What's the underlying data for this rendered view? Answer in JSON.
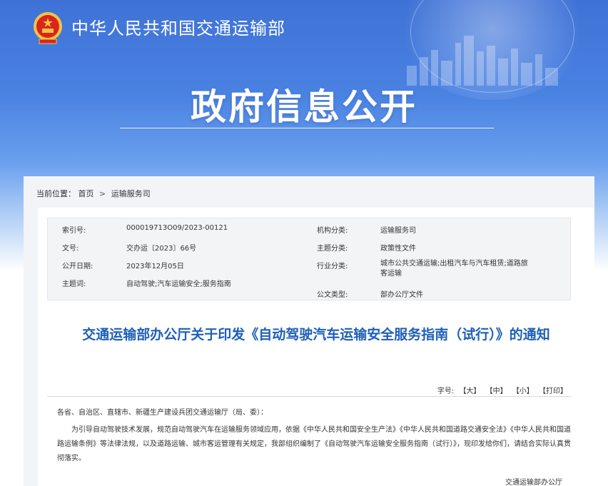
{
  "header": {
    "site_title": "中华人民共和国交通运输部",
    "hero_title": "政府信息公开"
  },
  "breadcrumb": {
    "label": "当前位置：",
    "items": [
      "首页",
      "运输服务司"
    ],
    "separator": ">"
  },
  "meta": {
    "rows": [
      {
        "label1": "索引号:",
        "value1": "000019713O09/2023-00121",
        "label2": "机构分类:",
        "value2": "运输服务司"
      },
      {
        "label1": "文号:",
        "value1": "交办运〔2023〕66号",
        "label2": "主题分类:",
        "value2": "政策性文件"
      },
      {
        "label1": "公开日期:",
        "value1": "2023年12月05日",
        "label2": "行业分类:",
        "value2": "城市公共交通运输;出租汽车与汽车租赁;道路旅客运输"
      },
      {
        "label1": "主题词:",
        "value1": "自动驾驶;汽车运输安全;服务指南",
        "label2": "",
        "value2": ""
      },
      {
        "label1": "",
        "value1": "",
        "label2": "公文类型:",
        "value2": "部办公厅文件"
      }
    ]
  },
  "document": {
    "title": "交通运输部办公厅关于印发《自动驾驶汽车运输安全服务指南（试行）》的通知",
    "font_size_label": "字号:",
    "font_size_options": [
      "【大】",
      "【中】",
      "【小】",
      "【打印】"
    ],
    "paragraphs": [
      "各省、自治区、直辖市、新疆生产建设兵团交通运输厅（局、委）：",
      "为引导自动驾驶技术发展，规范自动驾驶汽车在运输服务领域应用，依据《中华人民共和国安全生产法》《中华人民共和国道路交通安全法》《中华人民共和国道路运输条例》等法律法规，以及道路运输、城市客运管理有关规定，我部组织编制了《自动驾驶汽车运输安全服务指南（试行）》，现印发给你们，请结合实际认真贯彻落实。"
    ],
    "signature": "交通运输部办公厅"
  },
  "colors": {
    "banner_top": "#3f72d6",
    "title_blue": "#1d5fb8",
    "emblem_red": "#d8261c",
    "emblem_gold": "#f6c343"
  }
}
